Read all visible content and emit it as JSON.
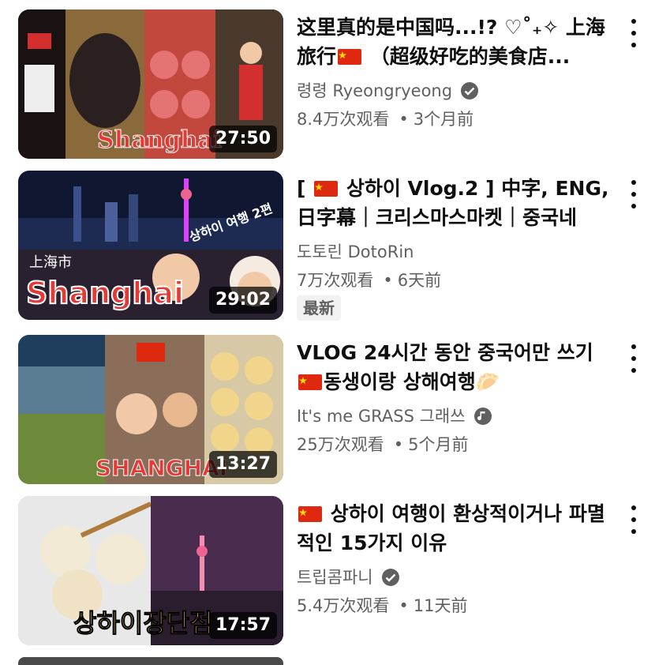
{
  "videos": [
    {
      "title_pre": "这里真的是中国吗...!? ♡˚₊✧ 上海旅行",
      "title_post": " （超级好吃的美食店...",
      "channel": "령령 Ryeongryeong",
      "verified": "check",
      "views": "8.4万次观看",
      "age": "3个月前",
      "duration": "27:50",
      "thumb_text": "Shanghai",
      "colors": {
        "bg": "#7a3b2e",
        "accent": "#e53935"
      }
    },
    {
      "title_pre": "[ ",
      "title_post": " 상하이 Vlog.2 ] 中字, ENG,日字幕｜크리스마스마켓｜중국네일...",
      "channel": "도토린 DotoRin",
      "verified": "",
      "views": "7万次观看",
      "age": "6天前",
      "badge": "最新",
      "duration": "29:02",
      "thumb_text": "Shanghai",
      "thumb_sub": "上海市",
      "thumb_tag": "상하이 여행 2편",
      "colors": {
        "bg": "#1b2a4a",
        "accent": "#e53935"
      }
    },
    {
      "title_pre": "VLOG 24시간 동안 중국어만 쓰기 ",
      "title_post": "동생이랑 상해여행🥟",
      "channel": "It's me GRASS 그래쓰",
      "verified": "music",
      "views": "25万次观看",
      "age": "5个月前",
      "duration": "13:27",
      "thumb_text": "SHANGHAI",
      "colors": {
        "bg": "#3e6e8e",
        "accent": "#e53935"
      }
    },
    {
      "title_pre": "",
      "title_post": " 상하이 여행이 환상적이거나 파멸적인 15가지 이유",
      "channel": "트립콤파니",
      "verified": "check",
      "views": "5.4万次观看",
      "age": "11天前",
      "duration": "17:57",
      "thumb_text": "상하이장단점",
      "colors": {
        "bg": "#5a3b5e",
        "accent": "#ffd54f"
      }
    }
  ],
  "ui": {
    "dot": "•",
    "more_icon": "three-dot-vertical",
    "flag_icon": "china-flag"
  }
}
